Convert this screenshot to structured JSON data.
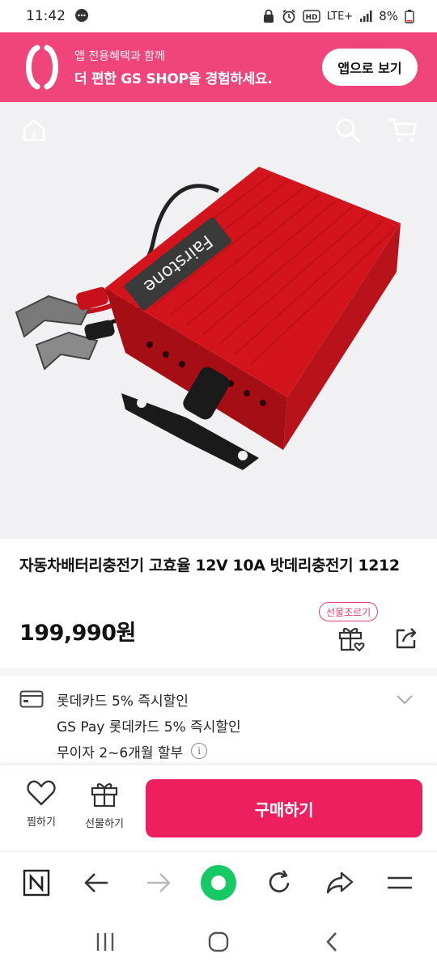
{
  "status_bar": {
    "time": "11:42",
    "battery": "8%",
    "network": "LTE+"
  },
  "app_banner": {
    "line1": "앱 전용혜택과 함께",
    "line2": "더 편한 GS SHOP을 경험하세요.",
    "button_label": "앱으로 보기",
    "color": "#f0457a"
  },
  "top_nav": {
    "icons": [
      "home-icon",
      "search-icon",
      "cart-icon"
    ]
  },
  "product": {
    "image_brand_text": "Fairstone",
    "title": "자동차배터리충전기 고효율 12V 10A 밧데리충전기 1212",
    "price": "199,990원",
    "gift_tag": "선물조르기"
  },
  "benefits": {
    "card_line": "롯데카드 5% 즉시할인",
    "pay_line": "GS Pay 롯데카드 5% 즉시할인",
    "installment_line": "무이자 2~6개월 할부"
  },
  "buy_bar": {
    "wish_label": "찜하기",
    "gift_label": "선물하기",
    "buy_label": "구매하기",
    "accent": "#ee1f5f"
  },
  "browser_bar": {
    "icons": [
      "naver-n-icon",
      "back-arrow-icon",
      "forward-arrow-icon",
      "green-dot-home-icon",
      "refresh-icon",
      "share-arrow-icon",
      "menu-icon"
    ]
  },
  "android_nav": {
    "icons": [
      "recents-icon",
      "home-circle-icon",
      "back-chevron-icon"
    ]
  }
}
